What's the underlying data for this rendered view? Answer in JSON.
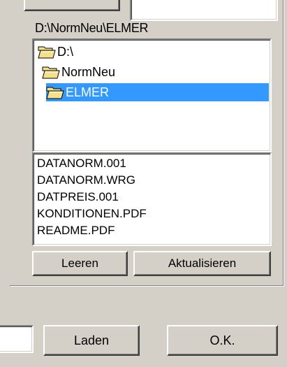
{
  "path_label": "D:\\NormNeu\\ELMER",
  "directory_tree": [
    {
      "label": "D:\\",
      "icon": "folder-open-icon",
      "selected": false
    },
    {
      "label": "NormNeu",
      "icon": "folder-open-icon",
      "selected": false
    },
    {
      "label": "ELMER",
      "icon": "folder-open-icon",
      "selected": true
    }
  ],
  "files": [
    "DATANORM.001",
    "DATANORM.WRG",
    "DATPREIS.001",
    "KONDITIONEN.PDF",
    "README.PDF"
  ],
  "buttons": {
    "clear": "Leeren",
    "refresh": "Aktualisieren",
    "load": "Laden",
    "ok": "O.K."
  },
  "colors": {
    "window_bg": "#d4d0c8",
    "selection": "#3399ff",
    "folder_fill": "#f5e08c"
  }
}
